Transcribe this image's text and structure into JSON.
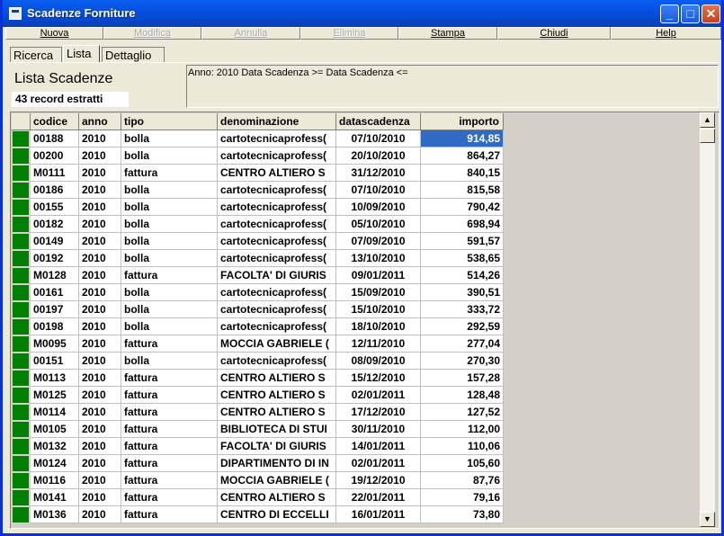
{
  "window": {
    "title": "Scadenze Forniture"
  },
  "toolbar": [
    {
      "label": "Nuova",
      "enabled": true
    },
    {
      "label": "Modifica",
      "enabled": false
    },
    {
      "label": "Annulla",
      "enabled": false
    },
    {
      "label": "Elimina",
      "enabled": false
    },
    {
      "label": "Stampa",
      "enabled": true
    },
    {
      "label": "Chiudi",
      "enabled": true
    },
    {
      "label": "Help",
      "enabled": true
    }
  ],
  "tabs": [
    {
      "label": "Ricerca",
      "active": false
    },
    {
      "label": "Lista",
      "active": true
    },
    {
      "label": "Dettaglio",
      "active": false
    }
  ],
  "list": {
    "title": "Lista Scadenze",
    "record_count": "43 record estratti"
  },
  "filter": {
    "text": "Anno: 2010   Data Scadenza >=     Data Scadenza <="
  },
  "columns": [
    "codice",
    "anno",
    "tipo",
    "denominazione",
    "datascadenza",
    "importo"
  ],
  "rows": [
    [
      "00188",
      "2010",
      "bolla",
      "cartotecnicaprofess(",
      "07/10/2010",
      "914,85"
    ],
    [
      "00200",
      "2010",
      "bolla",
      "cartotecnicaprofess(",
      "20/10/2010",
      "864,27"
    ],
    [
      "M0111",
      "2010",
      "fattura",
      "CENTRO ALTIERO S",
      "31/12/2010",
      "840,15"
    ],
    [
      "00186",
      "2010",
      "bolla",
      "cartotecnicaprofess(",
      "07/10/2010",
      "815,58"
    ],
    [
      "00155",
      "2010",
      "bolla",
      "cartotecnicaprofess(",
      "10/09/2010",
      "790,42"
    ],
    [
      "00182",
      "2010",
      "bolla",
      "cartotecnicaprofess(",
      "05/10/2010",
      "698,94"
    ],
    [
      "00149",
      "2010",
      "bolla",
      "cartotecnicaprofess(",
      "07/09/2010",
      "591,57"
    ],
    [
      "00192",
      "2010",
      "bolla",
      "cartotecnicaprofess(",
      "13/10/2010",
      "538,65"
    ],
    [
      "M0128",
      "2010",
      "fattura",
      "FACOLTA' DI GIURIS",
      "09/01/2011",
      "514,26"
    ],
    [
      "00161",
      "2010",
      "bolla",
      "cartotecnicaprofess(",
      "15/09/2010",
      "390,51"
    ],
    [
      "00197",
      "2010",
      "bolla",
      "cartotecnicaprofess(",
      "15/10/2010",
      "333,72"
    ],
    [
      "00198",
      "2010",
      "bolla",
      "cartotecnicaprofess(",
      "18/10/2010",
      "292,59"
    ],
    [
      "M0095",
      "2010",
      "fattura",
      "MOCCIA GABRIELE (",
      "12/11/2010",
      "277,04"
    ],
    [
      "00151",
      "2010",
      "bolla",
      "cartotecnicaprofess(",
      "08/09/2010",
      "270,30"
    ],
    [
      "M0113",
      "2010",
      "fattura",
      "CENTRO ALTIERO S",
      "15/12/2010",
      "157,28"
    ],
    [
      "M0125",
      "2010",
      "fattura",
      "CENTRO ALTIERO S",
      "02/01/2011",
      "128,48"
    ],
    [
      "M0114",
      "2010",
      "fattura",
      "CENTRO ALTIERO S",
      "17/12/2010",
      "127,52"
    ],
    [
      "M0105",
      "2010",
      "fattura",
      "BIBLIOTECA DI STUI",
      "30/11/2010",
      "112,00"
    ],
    [
      "M0132",
      "2010",
      "fattura",
      "FACOLTA' DI GIURIS",
      "14/01/2011",
      "110,06"
    ],
    [
      "M0124",
      "2010",
      "fattura",
      "DIPARTIMENTO DI IN",
      "02/01/2011",
      "105,60"
    ],
    [
      "M0116",
      "2010",
      "fattura",
      "MOCCIA GABRIELE (",
      "19/12/2010",
      "87,76"
    ],
    [
      "M0141",
      "2010",
      "fattura",
      "CENTRO ALTIERO S",
      "22/01/2011",
      "79,16"
    ],
    [
      "M0136",
      "2010",
      "fattura",
      "CENTRO DI ECCELLI",
      "16/01/2011",
      "73,80"
    ]
  ],
  "selected_row": 0,
  "colors": {
    "selector": "#007f00",
    "highlight": "#316ac5"
  }
}
